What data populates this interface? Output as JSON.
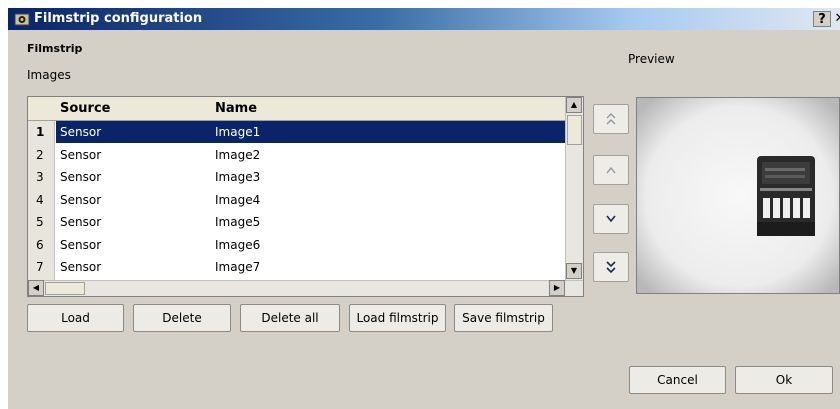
{
  "window": {
    "title": "Filmstrip configuration",
    "help_label": "?",
    "close_label": "✕"
  },
  "filmstrip_label": "Filmstrip",
  "images_label": "Images",
  "preview_label": "Preview",
  "table": {
    "columns": [
      "Source",
      "Name"
    ],
    "rows": [
      {
        "num": "1",
        "source": "Sensor",
        "name": "Image1"
      },
      {
        "num": "2",
        "source": "Sensor",
        "name": "Image2"
      },
      {
        "num": "3",
        "source": "Sensor",
        "name": "Image3"
      },
      {
        "num": "4",
        "source": "Sensor",
        "name": "Image4"
      },
      {
        "num": "5",
        "source": "Sensor",
        "name": "Image5"
      },
      {
        "num": "6",
        "source": "Sensor",
        "name": "Image6"
      },
      {
        "num": "7",
        "source": "Sensor",
        "name": "Image7"
      }
    ],
    "selected_row": "1"
  },
  "move_buttons": {
    "top": "⌃",
    "up": "^",
    "down": "v",
    "bottom": "⌄"
  },
  "buttons": {
    "load": "Load",
    "delete": "Delete",
    "delete_all": "Delete all",
    "load_filmstrip": "Load filmstrip",
    "save_filmstrip": "Save filmstrip",
    "cancel": "Cancel",
    "ok": "Ok"
  },
  "colors": {
    "selection": "#0a246a",
    "title_bar": "#0a246a"
  }
}
